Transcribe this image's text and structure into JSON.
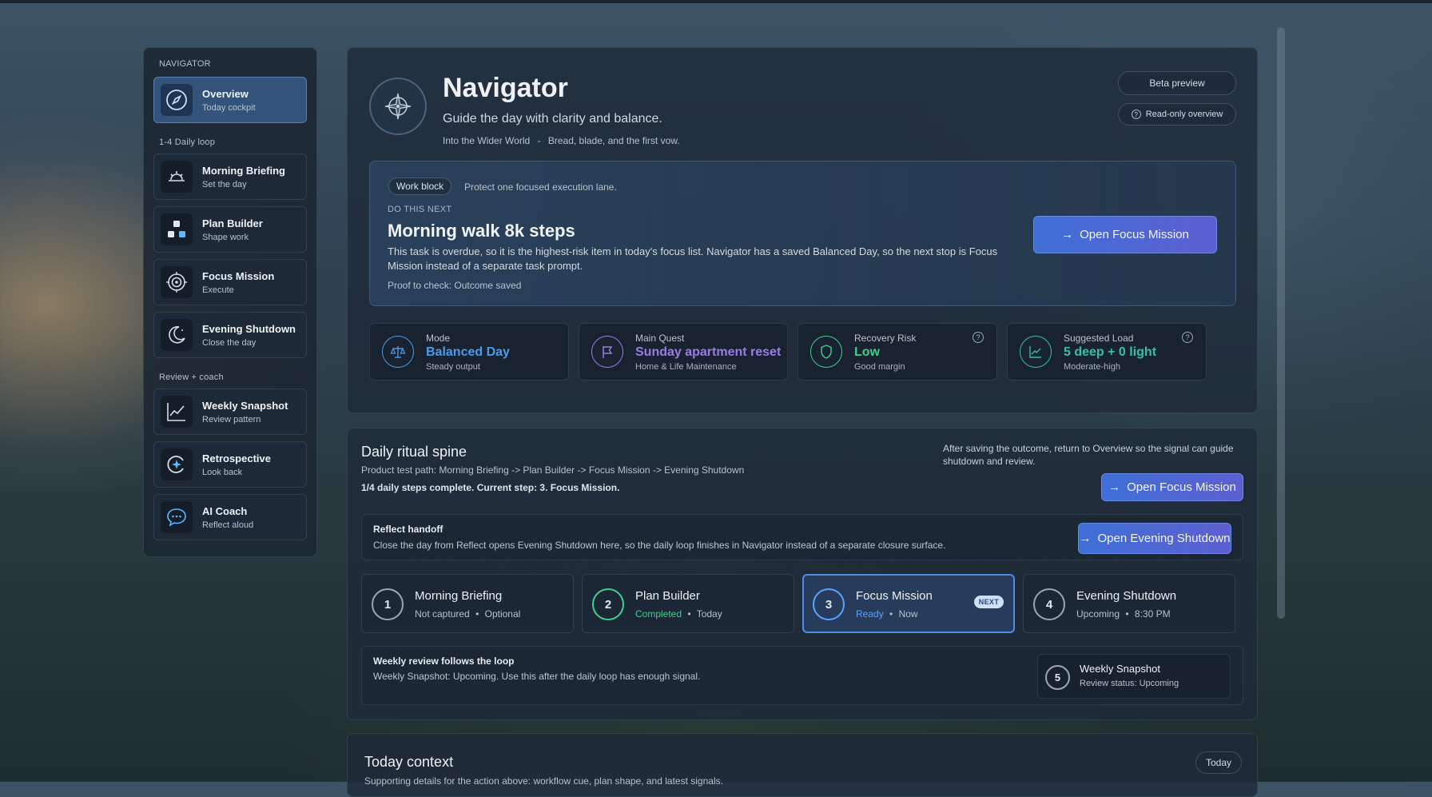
{
  "colors": {
    "accent_blue": "#4d8de6",
    "accent_purple": "#8e72e0",
    "accent_green": "#3fcf8a",
    "accent_teal": "#35c0a5"
  },
  "sidebar": {
    "heading": "NAVIGATOR",
    "overview": {
      "title": "Overview",
      "sub": "Today cockpit",
      "icon": "compass-icon"
    },
    "section_daily": "1-4 Daily loop",
    "daily": [
      {
        "title": "Morning Briefing",
        "sub": "Set the day",
        "icon": "sunrise-icon"
      },
      {
        "title": "Plan Builder",
        "sub": "Shape work",
        "icon": "blocks-icon"
      },
      {
        "title": "Focus Mission",
        "sub": "Execute",
        "icon": "target-icon"
      },
      {
        "title": "Evening Shutdown",
        "sub": "Close the day",
        "icon": "moon-icon"
      }
    ],
    "section_review": "Review + coach",
    "review": [
      {
        "title": "Weekly Snapshot",
        "sub": "Review pattern",
        "icon": "line-chart-icon"
      },
      {
        "title": "Retrospective",
        "sub": "Look back",
        "icon": "retro-icon"
      },
      {
        "title": "AI Coach",
        "sub": "Reflect aloud",
        "icon": "chat-icon"
      }
    ]
  },
  "header": {
    "title": "Navigator",
    "subtitle": "Guide the day with clarity and balance.",
    "meta_world": "Into the Wider World",
    "meta_sep": "-",
    "meta_chapter": "Bread, blade, and the first vow.",
    "beta": "Beta preview",
    "readonly": "Read-only overview"
  },
  "next": {
    "tag": "Work block",
    "tag_note": "Protect one focused execution lane.",
    "eyebrow": "DO THIS NEXT",
    "title": "Morning walk 8k steps",
    "desc": "This task is overdue, so it is the highest-risk item in today's focus list. Navigator has a saved Balanced Day, so the next stop is Focus Mission instead of a separate task prompt.",
    "proof": "Proof to check: Outcome saved",
    "button": "Open Focus Mission"
  },
  "stats": [
    {
      "label": "Mode",
      "value": "Balanced Day",
      "sub": "Steady output",
      "color": "#4d9be8",
      "icon": "balance-scale-icon"
    },
    {
      "label": "Main Quest",
      "value": "Sunday apartment reset",
      "sub": "Home & Life Maintenance",
      "color": "#9a7ce6",
      "icon": "flag-icon"
    },
    {
      "label": "Recovery Risk",
      "value": "Low",
      "sub": "Good margin",
      "color": "#3fcf8a",
      "icon": "shield-icon"
    },
    {
      "label": "Suggested Load",
      "value": "5 deep + 0 light",
      "sub": "Moderate-high",
      "color": "#35c0a5",
      "icon": "trend-icon"
    }
  ],
  "spine": {
    "title": "Daily ritual spine",
    "path": "Product test path: Morning Briefing -> Plan Builder -> Focus Mission -> Evening Shutdown",
    "progress": "1/4 daily steps complete. Current step: 3. Focus Mission.",
    "note": "After saving the outcome, return to Overview so the signal can guide shutdown and review.",
    "button_focus": "Open Focus Mission",
    "handoff_title": "Reflect handoff",
    "handoff_desc": "Close the day from Reflect opens Evening Shutdown here, so the daily loop finishes in Navigator instead of a separate closure surface.",
    "button_shutdown": "Open Evening Shutdown",
    "steps": [
      {
        "num": "1",
        "title": "Morning Briefing",
        "status": "Not captured",
        "sep": "•",
        "when": "Optional",
        "status_color": "#b7c1cc",
        "ring": "#9aa6b3"
      },
      {
        "num": "2",
        "title": "Plan Builder",
        "status": "Completed",
        "sep": "•",
        "when": "Today",
        "status_color": "#3fcf8a",
        "ring": "#3fcf8a"
      },
      {
        "num": "3",
        "title": "Focus Mission",
        "status": "Ready",
        "sep": "•",
        "when": "Now",
        "badge": "NEXT",
        "status_color": "#5aa2ff",
        "ring": "#5aa2ff"
      },
      {
        "num": "4",
        "title": "Evening Shutdown",
        "status": "Upcoming",
        "sep": "•",
        "when": "8:30 PM",
        "status_color": "#b7c1cc",
        "ring": "#9aa6b3"
      }
    ],
    "weekly_title": "Weekly review follows the loop",
    "weekly_desc": "Weekly Snapshot: Upcoming. Use this after the daily loop has enough signal.",
    "weekly_step": {
      "num": "5",
      "title": "Weekly Snapshot",
      "sub": "Review status: Upcoming"
    }
  },
  "context": {
    "title": "Today context",
    "sub": "Supporting details for the action above: workflow cue, plan shape, and latest signals.",
    "badge": "Today"
  }
}
